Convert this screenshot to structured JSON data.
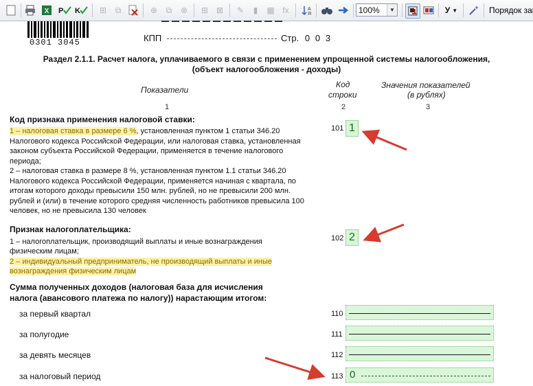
{
  "toolbar": {
    "zoom_value": "100%",
    "order_label": "Порядок зап",
    "underline_label": "У",
    "fill_label": "fx"
  },
  "document": {
    "barcode_number": "0301 3045",
    "kpp_label": "КПП",
    "page_label": "Стр.",
    "page_digits": [
      "0",
      "0",
      "3"
    ],
    "title_line1": "Раздел 2.1.1. Расчет налога, уплачиваемого в связи с применением упрощенной системы налогообложения,",
    "title_line2": "(объект налогообложения - доходы)",
    "col_indicators": "Показатели",
    "col_code_line1": "Код",
    "col_code_line2": "строки",
    "col_values_line1": "Значения показателей",
    "col_values_line2": "(в рублях)",
    "col_num1": "1",
    "col_num2": "2",
    "col_num3": "3",
    "rate_heading": "Код признака применения налоговой ставки:",
    "rate_opt1_highlight": "1 – налоговая ставка в размере 6 %",
    "rate_opt1_rest": ", установленная пунктом 1 статьи 346.20",
    "rate_line2": "Налогового кодекса Российской Федерации, или налоговая ставка, установленная",
    "rate_line3": "законом субъекта Российской Федерации, применяется в течение налогового",
    "rate_line4": "периода;",
    "rate_line5": "2 – налоговая ставка в размере 8 %, установленная пунктом 1.1 статьи 346.20",
    "rate_line6": "Налогового кодекса Российской Федерации, применяется начиная с квартала, по",
    "rate_line7": "итогам которого доходы превысили 150 млн. рублей, но не превысили 200 млн.",
    "rate_line8": "рублей и (или) в течение которого средняя численность работников превысила 100",
    "rate_line9": "человек, но не превысила 130 человек",
    "code_101": "101",
    "value_101": "1",
    "payer_heading": "Признак налогоплательщика:",
    "payer_line1": "1 – налогоплательщик, производящий выплаты и иные вознаграждения",
    "payer_line2": "физическим лицам;",
    "payer_line3": "2 – индивидуальный предприниматель, не производящий выплаты и иные",
    "payer_line4": "вознаграждения физическим лицам",
    "code_102": "102",
    "value_102": "2",
    "income_heading_line1": "Сумма полученных доходов (налоговая база для исчисления",
    "income_heading_line2": "налога (авансового платежа по налогу)) нарастающим итогом:",
    "rows": [
      {
        "label": "за первый квартал",
        "code": "110",
        "value": ""
      },
      {
        "label": "за полугодие",
        "code": "111",
        "value": ""
      },
      {
        "label": "за девять месяцев",
        "code": "112",
        "value": ""
      },
      {
        "label": "за налоговый период",
        "code": "113",
        "value": "0"
      }
    ]
  },
  "colors": {
    "highlight": "#fff2a8",
    "field_green": "#d9f6d9",
    "arrow_red": "#d63b2f"
  }
}
